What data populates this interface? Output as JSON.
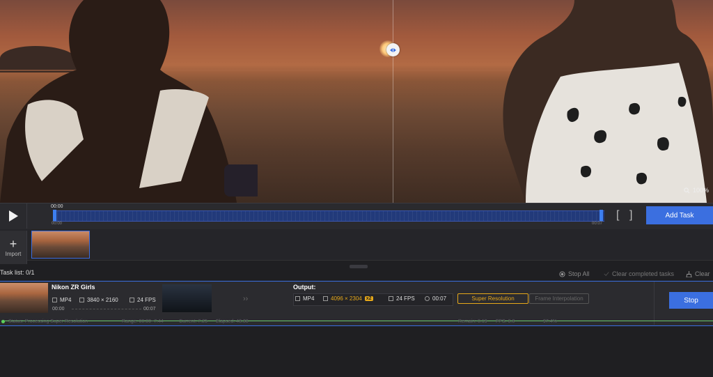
{
  "preview": {
    "zoom_label": "100%"
  },
  "timeline": {
    "current_time": "00:00",
    "start_time": "00:00",
    "end_time": "00:07",
    "bracket_open": "[",
    "bracket_close": "]",
    "add_task_label": "Add Task"
  },
  "sources": {
    "import_plus": "+",
    "import_label": "Import"
  },
  "task_list": {
    "title": "Task list: 0/1",
    "stop_all_label": "Stop All",
    "clear_completed_label": "Clear completed tasks",
    "clear_label": "Clear"
  },
  "task": {
    "name": "Nikon ZR Girls",
    "input": {
      "format": "MP4",
      "resolution": "3840 × 2160",
      "fps": "24 FPS",
      "time_start": "00:00",
      "time_end": "00:07"
    },
    "output_label": "Output:",
    "output": {
      "format": "MP4",
      "resolution": "4096 × 2304",
      "scale": "x2",
      "fps": "24 FPS",
      "duration": "00:07"
    },
    "super_resolution_label": "Super Resolution",
    "frame_interpolation_label": "Frame Interpolation",
    "stop_label": "Stop",
    "status": {
      "status_text": "Status: Processing Super Resolution",
      "range_text": "Range: 00:00~7.44",
      "current_text": "Current: 7.25",
      "elapsed_text": "Elapsed: 48.38",
      "remain_text": "Remain: 0.19",
      "fps_text": "FPS: 3.8",
      "percent_text": "97.4%"
    }
  },
  "colors": {
    "accent": "#3b6fe0",
    "highlight": "#e6a81a",
    "progress": "#6cc86c"
  }
}
